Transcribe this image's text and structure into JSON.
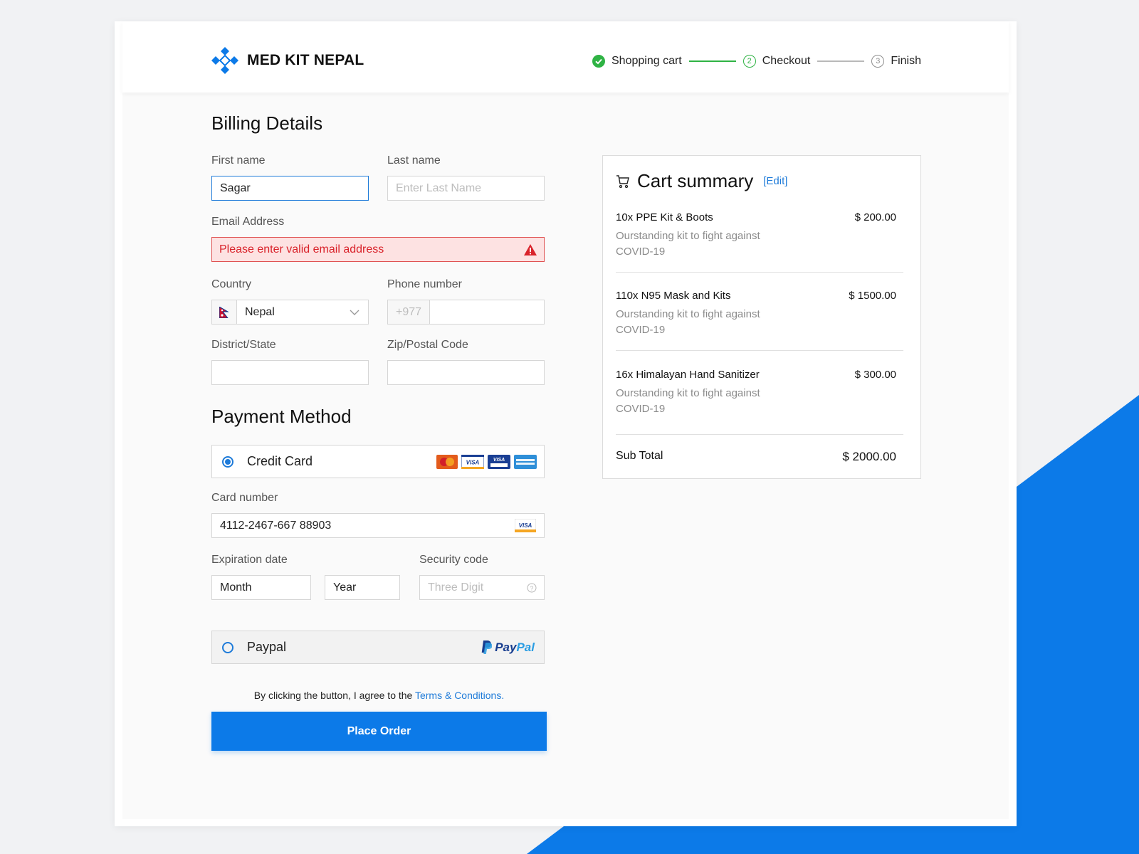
{
  "brand": {
    "name": "MED KIT NEPAL",
    "accent": "#0c7ae8"
  },
  "steps": [
    {
      "label": "Shopping cart",
      "state": "done"
    },
    {
      "label": "Checkout",
      "number": "2",
      "state": "active"
    },
    {
      "label": "Finish",
      "number": "3",
      "state": "idle"
    }
  ],
  "billing": {
    "title": "Billing Details",
    "first_name": {
      "label": "First name",
      "value": "Sagar"
    },
    "last_name": {
      "label": "Last name",
      "placeholder": "Enter Last Name"
    },
    "email": {
      "label": "Email Address",
      "error": "Please enter valid email address"
    },
    "country": {
      "label": "Country",
      "value": "Nepal"
    },
    "phone": {
      "label": "Phone number",
      "prefix": "+977",
      "value": ""
    },
    "district": {
      "label": "District/State",
      "value": ""
    },
    "zip": {
      "label": "Zip/Postal Code",
      "value": ""
    }
  },
  "payment": {
    "title": "Payment Method",
    "credit_card": {
      "label": "Credit Card",
      "selected": true
    },
    "card_number": {
      "label": "Card number",
      "value": "4112-2467-667 88903"
    },
    "expiration": {
      "label": "Expiration date",
      "month": "Month",
      "year": "Year"
    },
    "security": {
      "label": "Security code",
      "placeholder": "Three Digit"
    },
    "paypal": {
      "label": "Paypal",
      "selected": false,
      "logo_text_1": "Pay",
      "logo_text_2": "Pal"
    }
  },
  "terms": {
    "prefix": "By clicking the button, I agree to the ",
    "link": "Terms & Conditions."
  },
  "place_order": "Place Order",
  "cart": {
    "title": "Cart summary",
    "edit": "[Edit]",
    "items": [
      {
        "name": "10x PPE Kit & Boots",
        "price": "$ 200.00",
        "desc": "Ourstanding kit to fight against COVID-19"
      },
      {
        "name": "110x N95 Mask and Kits",
        "price": "$ 1500.00",
        "desc": "Ourstanding kit to fight against COVID-19"
      },
      {
        "name": "16x Himalayan Hand Sanitizer",
        "price": "$ 300.00",
        "desc": "Ourstanding kit to fight against COVID-19"
      }
    ],
    "subtotal_label": "Sub Total",
    "subtotal_value": "$ 2000.00"
  }
}
